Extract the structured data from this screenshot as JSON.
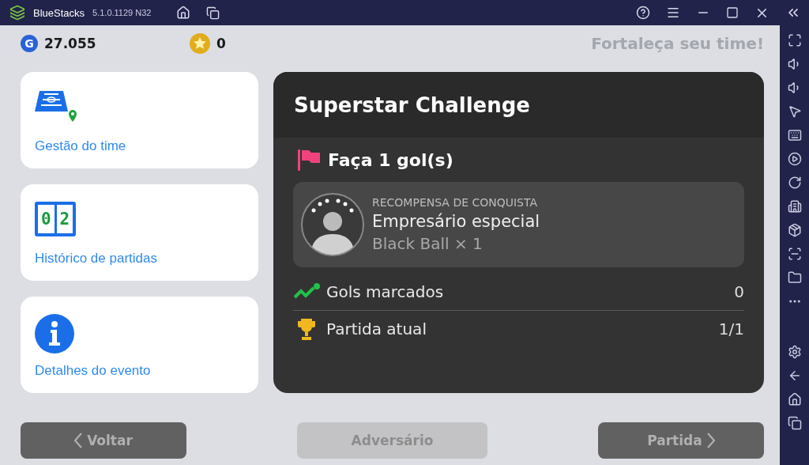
{
  "app": {
    "name": "BlueStacks",
    "version": "5.1.0.1129 N32"
  },
  "currencies": [
    {
      "kind": "gp",
      "symbol": "G",
      "amount": "27.055"
    },
    {
      "kind": "star",
      "amount": "0"
    }
  ],
  "banner": "Fortaleça seu time!",
  "menu": [
    {
      "kind": "field",
      "label": "Gestão do time"
    },
    {
      "kind": "score",
      "label": "Histórico de partidas",
      "score": [
        "0",
        "2"
      ]
    },
    {
      "kind": "info",
      "label": "Detalhes do evento"
    }
  ],
  "challenge": {
    "title": "Superstar Challenge",
    "goal": "Faça 1 gol(s)",
    "reward": {
      "caption": "RECOMPENSA DE CONQUISTA",
      "name": "Empresário especial",
      "item": "Black Ball × 1"
    },
    "stats": [
      {
        "kind": "goals",
        "label": "Gols marcados",
        "value": "0"
      },
      {
        "kind": "match",
        "label": "Partida atual",
        "value": "1/1"
      }
    ]
  },
  "buttons": [
    {
      "kind": "back",
      "label": "Voltar",
      "disabled": false
    },
    {
      "kind": "plain",
      "label": "Adversário",
      "disabled": true
    },
    {
      "kind": "next",
      "label": "Partida",
      "disabled": false
    }
  ]
}
